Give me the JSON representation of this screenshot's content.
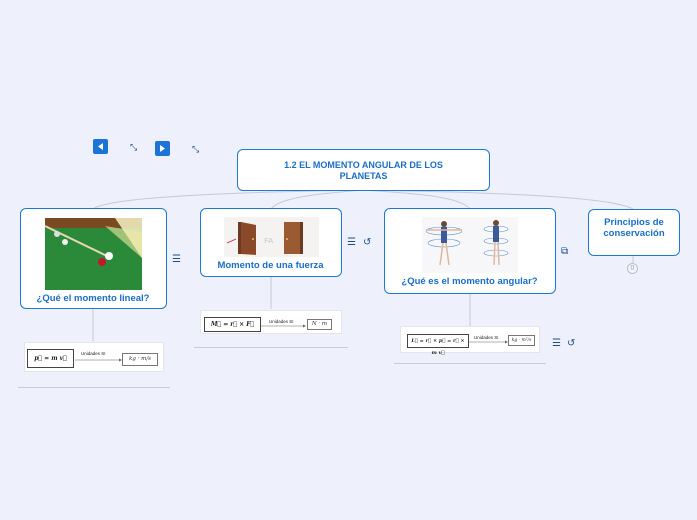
{
  "root": {
    "title": "1.2 EL MOMENTO ANGULAR DE LOS PLANETAS"
  },
  "nodes": [
    {
      "label": "¿Qué el momento lineal?"
    },
    {
      "label": "Momento de una fuerza"
    },
    {
      "label": "¿Qué es el momento angular?"
    },
    {
      "label": "Principios de conservación"
    }
  ],
  "formulas": {
    "linear": {
      "eq": "p⃗ = m v⃗",
      "caption": "Unidades SI",
      "unit": "kg · m/s"
    },
    "torque": {
      "eq": "M⃗ = r⃗ × F⃗",
      "caption": "Unidades SI",
      "unit": "N · m"
    },
    "angular": {
      "eq": "L⃗ = r⃗ × p⃗ = r⃗ × m v⃗",
      "caption": "Unidades SI",
      "unit": "kg · m²/s"
    }
  },
  "collapsed_count": "0",
  "colors": {
    "accent": "#1c7ad2",
    "background": "#eef0fb"
  },
  "icons": [
    "prev-slide-icon",
    "next-slide-icon",
    "expand-icon",
    "notes-icon",
    "attachment-icon",
    "external-link-icon"
  ]
}
